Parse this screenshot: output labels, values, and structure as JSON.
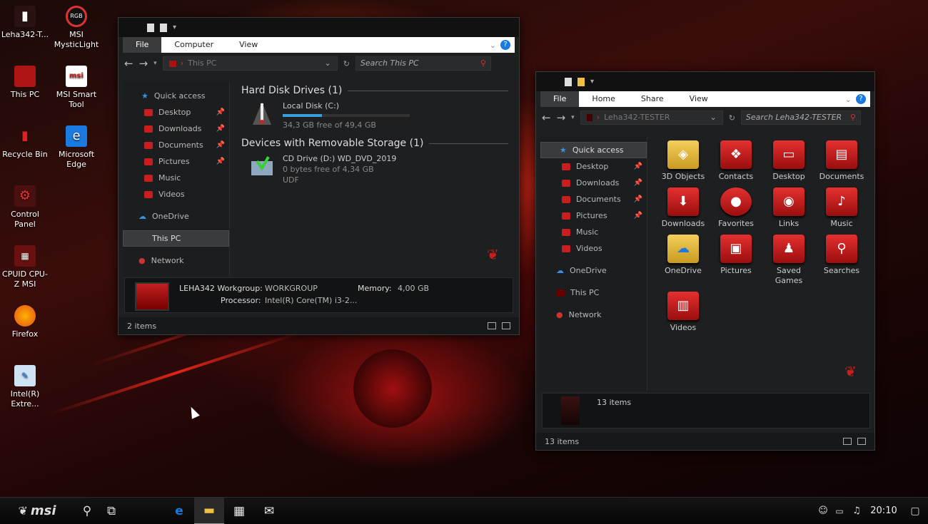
{
  "desktop": {
    "icons": [
      {
        "label": "Leha342-T...",
        "icon": "user-folder-icon"
      },
      {
        "label": "MSI MysticLight",
        "icon": "rgb-icon"
      },
      {
        "label": "This PC",
        "icon": "monitor-icon"
      },
      {
        "label": "MSI Smart Tool",
        "icon": "msi-icon"
      },
      {
        "label": "Recycle Bin",
        "icon": "recycle-bin-icon"
      },
      {
        "label": "Microsoft Edge",
        "icon": "edge-icon"
      },
      {
        "label": "Control Panel",
        "icon": "control-panel-icon"
      },
      {
        "label": "CPUID CPU-Z MSI",
        "icon": "cpu-icon"
      },
      {
        "label": "Firefox",
        "icon": "firefox-icon"
      },
      {
        "label": "Intel(R) Extre...",
        "icon": "intel-icon"
      }
    ]
  },
  "win1": {
    "tabs": {
      "file": "File",
      "computer": "Computer",
      "view": "View"
    },
    "path": "This PC",
    "search_placeholder": "Search This PC",
    "nav": {
      "quick_access": "Quick access",
      "desktop": "Desktop",
      "downloads": "Downloads",
      "documents": "Documents",
      "pictures": "Pictures",
      "music": "Music",
      "videos": "Videos",
      "onedrive": "OneDrive",
      "this_pc": "This PC",
      "network": "Network"
    },
    "group_hdd": "Hard Disk Drives (1)",
    "group_removable": "Devices with Removable Storage (1)",
    "local_disk": {
      "name": "Local Disk (C:)",
      "free": "34,3 GB free of 49,4 GB",
      "used_fraction": 0.31
    },
    "cd_drive": {
      "name": "CD Drive (D:) WD_DVD_2019",
      "free": "0 bytes free of 4,34 GB",
      "fs": "UDF"
    },
    "details": {
      "computer": "LEHA342",
      "workgroup_label": "Workgroup:",
      "workgroup": "WORKGROUP",
      "memory_label": "Memory:",
      "memory": "4,00 GB",
      "processor_label": "Processor:",
      "processor": "Intel(R) Core(TM) i3-2..."
    },
    "status": "2 items"
  },
  "win2": {
    "tabs": {
      "file": "File",
      "home": "Home",
      "share": "Share",
      "view": "View"
    },
    "path": "Leha342-TESTER",
    "search_placeholder": "Search Leha342-TESTER",
    "nav": {
      "quick_access": "Quick access",
      "desktop": "Desktop",
      "downloads": "Downloads",
      "documents": "Documents",
      "pictures": "Pictures",
      "music": "Music",
      "videos": "Videos",
      "onedrive": "OneDrive",
      "this_pc": "This PC",
      "network": "Network"
    },
    "items": [
      {
        "label": "3D Objects",
        "icon": "3d-objects-icon"
      },
      {
        "label": "Contacts",
        "icon": "contacts-icon"
      },
      {
        "label": "Desktop",
        "icon": "desktop-icon"
      },
      {
        "label": "Documents",
        "icon": "documents-icon"
      },
      {
        "label": "Downloads",
        "icon": "downloads-icon"
      },
      {
        "label": "Favorites",
        "icon": "favorites-icon"
      },
      {
        "label": "Links",
        "icon": "links-icon"
      },
      {
        "label": "Music",
        "icon": "music-icon"
      },
      {
        "label": "OneDrive",
        "icon": "onedrive-icon"
      },
      {
        "label": "Pictures",
        "icon": "pictures-icon"
      },
      {
        "label": "Saved Games",
        "icon": "saved-games-icon"
      },
      {
        "label": "Searches",
        "icon": "searches-icon"
      },
      {
        "label": "Videos",
        "icon": "videos-icon"
      }
    ],
    "details_count": "13 items",
    "status": "13 items"
  },
  "taskbar": {
    "brand": "msi",
    "clock": "20:10"
  },
  "colors": {
    "accent": "#c81e1e",
    "window_bg": "#1e1f21",
    "help_blue": "#1a7ae0"
  }
}
